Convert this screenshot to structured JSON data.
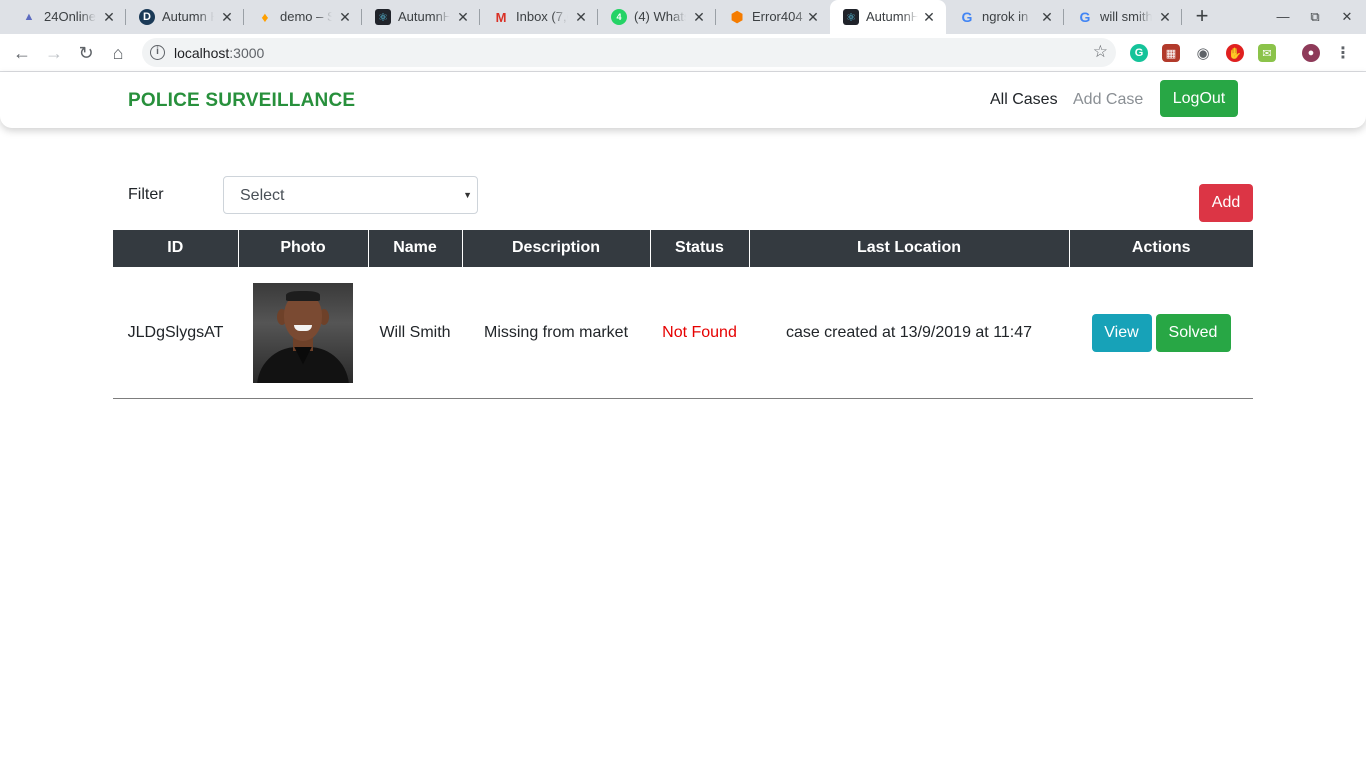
{
  "browser": {
    "tabs": [
      {
        "title": "24Online",
        "icon": "24online-icon",
        "icon_color": "#5c6bc0"
      },
      {
        "title": "Autumn H",
        "icon": "d-logo-icon",
        "icon_color": "#1b3a57"
      },
      {
        "title": "demo – S",
        "icon": "firebase-icon",
        "icon_color": "#ffca28"
      },
      {
        "title": "AutumnH",
        "icon": "react-icon",
        "icon_color": "#61dafb"
      },
      {
        "title": "Inbox (7,6",
        "icon": "gmail-icon",
        "icon_color": "#d93025"
      },
      {
        "title": "(4) Whats",
        "icon": "whatsapp-icon",
        "icon_color": "#25d366"
      },
      {
        "title": "Error404",
        "icon": "error404-icon",
        "icon_color": "#f57c00"
      },
      {
        "title": "AutumnH",
        "icon": "react-icon",
        "icon_color": "#61dafb",
        "active": true
      },
      {
        "title": "ngrok in",
        "icon": "google-icon",
        "icon_color": "#4285f4"
      },
      {
        "title": "will smith",
        "icon": "google-icon",
        "icon_color": "#4285f4"
      }
    ],
    "address": {
      "host": "localhost",
      "port": ":3000"
    }
  },
  "app": {
    "brand": "POLICE SURVEILLANCE",
    "nav": {
      "all_cases": "All Cases",
      "add_case": "Add Case",
      "logout": "LogOut"
    },
    "filter": {
      "label": "Filter",
      "selected": "Select"
    },
    "add_button": "Add",
    "table": {
      "headers": [
        "ID",
        "Photo",
        "Name",
        "Description",
        "Status",
        "Last Location",
        "Actions"
      ],
      "rows": [
        {
          "id": "JLDgSlygsAT",
          "name": "Will Smith",
          "description": "Missing from market",
          "status": "Not Found",
          "last_location": "case created at 13/9/2019 at 11:47",
          "actions": {
            "view": "View",
            "solved": "Solved"
          }
        }
      ]
    },
    "colors": {
      "brand": "#28903c",
      "status_not_found": "#e60000",
      "logout": "#28a745",
      "add": "#dc3545",
      "view": "#17a2b8",
      "solved": "#28a745",
      "table_header": "#343a40"
    }
  }
}
